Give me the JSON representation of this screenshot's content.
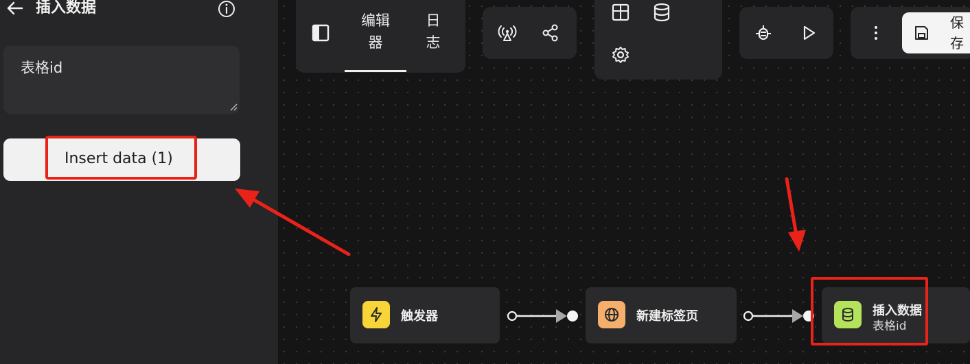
{
  "panel": {
    "title": "插入数据",
    "textarea_value": "表格id",
    "insert_button": "Insert data (1)"
  },
  "toolbar": {
    "tabs": [
      {
        "label_line1": "编辑",
        "label_line2": "器",
        "active": true
      },
      {
        "label_line1": "日",
        "label_line2": "志",
        "active": false
      }
    ],
    "save_label": "保存"
  },
  "nodes": [
    {
      "title": "触发器",
      "icon": "lightning-icon",
      "color": "#f7d437"
    },
    {
      "title": "新建标签页",
      "icon": "globe-icon",
      "color": "#f5ae6b"
    },
    {
      "title": "插入数据",
      "subtitle": "表格id",
      "icon": "database-icon",
      "color": "#b4e35b"
    }
  ],
  "colors": {
    "highlight": "#e9231a",
    "panel_bg": "#262628",
    "canvas_bg": "#151516"
  }
}
